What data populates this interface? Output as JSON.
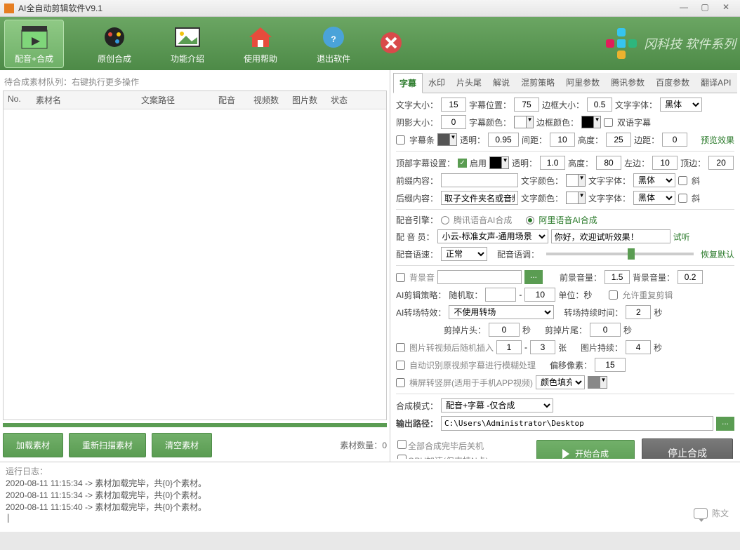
{
  "titlebar": {
    "title": "AI全自动剪辑软件V9.1"
  },
  "toolbar": {
    "items": [
      {
        "label": "配音+合成"
      },
      {
        "label": "原创合成"
      },
      {
        "label": "功能介绍"
      },
      {
        "label": "使用帮助"
      },
      {
        "label": "退出软件"
      }
    ],
    "brand": "冈科技 软件系列"
  },
  "left": {
    "hint": "待合成素材队列：右键执行更多操作",
    "cols": {
      "no": "No.",
      "name": "素材名",
      "path": "文案路径",
      "voice": "配音",
      "frames": "视频数",
      "pics": "图片数",
      "status": "状态"
    },
    "btn_load": "加载素材",
    "btn_rescan": "重新扫描素材",
    "btn_clear": "清空素材",
    "count_label": "素材数量：",
    "count_value": "0"
  },
  "tabs": [
    "字幕",
    "水印",
    "片头尾",
    "解说",
    "混剪策略",
    "阿里参数",
    "腾讯参数",
    "百度参数",
    "翻译API"
  ],
  "sub": {
    "font_size_l": "文字大小：",
    "font_size": "15",
    "pos_l": "字幕位置：",
    "pos": "75",
    "border_l": "边框大小：",
    "border": "0.5",
    "font_l": "文字字体：",
    "font": "黑体",
    "shadow_l": "阴影大小：",
    "shadow": "0",
    "color_l": "字幕颜色：",
    "bcolor_l": "边框颜色：",
    "bilingual": "双语字幕",
    "bar_l": "字幕条",
    "alpha_l": "透明：",
    "alpha": "0.95",
    "gap_l": "间距：",
    "gap": "10",
    "height_l": "高度：",
    "height": "25",
    "margin_l": "边距：",
    "margin": "0",
    "preview": "预览效果",
    "top_l": "顶部字幕设置：",
    "enable": "启用",
    "talpha_l": "透明：",
    "talpha": "1.0",
    "theight_l": "高度：",
    "theight": "80",
    "tleft_l": "左边：",
    "tleft": "10",
    "ttop_l": "顶边：",
    "ttop": "20",
    "prefix_l": "前缀内容：",
    "tfcolor_l": "文字颜色：",
    "tfont_l": "文字字体：",
    "tfont": "黑体",
    "italic": "斜",
    "suffix_l": "后缀内容：",
    "suffix": "取子文件夹名或音频",
    "sfcolor_l": "文字颜色：",
    "sfont_l": "文字字体：",
    "sfont": "黑体"
  },
  "voice": {
    "engine_l": "配音引擎：",
    "opt1": "腾讯语音AI合成",
    "opt2": "阿里语音AI合成",
    "person_l": "配 音 员：",
    "person": "小云-标准女声-通用场景",
    "sample": "你好，欢迎试听效果！",
    "try": "试听",
    "speed_l": "配音语速：",
    "speed": "正常",
    "pitch_l": "配音语调：",
    "reset": "恢复默认"
  },
  "bgm": {
    "bg_l": "背景音",
    "fg_vol_l": "前景音量：",
    "fg_vol": "1.5",
    "bg_vol_l": "背景音量：",
    "bg_vol": "0.2"
  },
  "ai": {
    "clip_l": "AI剪辑策略：",
    "rand_l": "随机取：",
    "to": "10",
    "unit": "单位：秒",
    "dup": "允许重复剪辑",
    "trans_l": "AI转场特效：",
    "trans": "不使用转场",
    "dur_l": "转场持续时间：",
    "dur": "2",
    "sec": "秒",
    "head_l": "剪掉片头：",
    "head": "0",
    "tail_l": "剪掉片尾：",
    "tail": "0",
    "pic_l": "图片转视频后随机插入",
    "pic_from": "1",
    "pic_to": "3",
    "zhang": "张",
    "pic_dur_l": "图片持续：",
    "pic_dur": "4",
    "blur": "自动识别原视频字幕进行模糊处理",
    "offset_l": "偏移像素：",
    "offset": "15",
    "rotate": "横屏转竖屏(适用于手机APP视频)",
    "fill": "颜色填充"
  },
  "out": {
    "mode_l": "合成模式：",
    "mode": "配音+字幕 -仅合成",
    "path_l": "输出路径：",
    "path": "C:\\Users\\Administrator\\Desktop",
    "shutdown": "全部合成完毕后关机",
    "gpu": "GPU加速(仅支持N卡)",
    "start": "开始合成",
    "stop": "停止合成"
  },
  "log": {
    "title": "运行日志：",
    "lines": [
      "2020-08-11 11:15:34 -> 素材加载完毕，共{0}个素材。",
      "2020-08-11 11:15:34 -> 素材加载完毕，共{0}个素材。",
      "2020-08-11 11:15:40 -> 素材加载完毕，共{0}个素材。"
    ]
  },
  "watermark": "陈文"
}
